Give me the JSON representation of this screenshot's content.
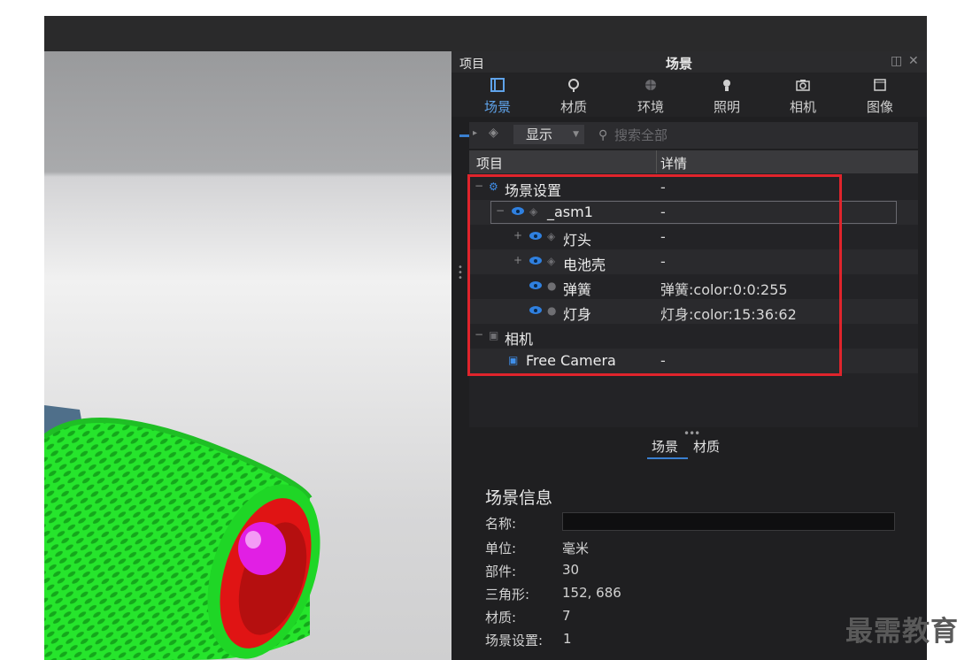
{
  "panel": {
    "title_left": "项目",
    "title": "场景",
    "restore_icon": "restore-icon",
    "close_icon": "close-icon"
  },
  "tabs": [
    {
      "label": "场景",
      "icon": "scene-icon",
      "active": true
    },
    {
      "label": "材质",
      "icon": "material-icon",
      "active": false
    },
    {
      "label": "环境",
      "icon": "environment-icon",
      "active": false
    },
    {
      "label": "照明",
      "icon": "lighting-icon",
      "active": false
    },
    {
      "label": "相机",
      "icon": "camera-icon",
      "active": false
    },
    {
      "label": "图像",
      "icon": "image-icon",
      "active": false
    }
  ],
  "toolbar": {
    "display_label": "显示",
    "search_placeholder": "搜索全部"
  },
  "tree": {
    "col_item": "项目",
    "col_detail": "详情",
    "rows": [
      {
        "label": "场景设置",
        "detail": "-"
      },
      {
        "label": "_asm1",
        "detail": "-"
      },
      {
        "label": "灯头",
        "detail": "-"
      },
      {
        "label": "电池壳",
        "detail": "-"
      },
      {
        "label": "弹簧",
        "detail": "弹簧:color:0:0:255"
      },
      {
        "label": "灯身",
        "detail": "灯身:color:15:36:62"
      },
      {
        "label": "相机",
        "detail": ""
      },
      {
        "label": "Free Camera",
        "detail": "-"
      }
    ]
  },
  "bottom_tabs": [
    {
      "label": "场景",
      "active": true
    },
    {
      "label": "材质",
      "active": false
    }
  ],
  "info": {
    "title": "场景信息",
    "name_label": "名称:",
    "name_value": "",
    "unit_label": "单位:",
    "unit_value": "毫米",
    "parts_label": "部件:",
    "parts_value": "30",
    "triangles_label": "三角形:",
    "triangles_value": "152, 686",
    "materials_label": "材质:",
    "materials_value": "7",
    "scene_settings_label": "场景设置:",
    "scene_settings_value": "1"
  },
  "watermark": "最需教育",
  "colors": {
    "accent": "#3a7fd0",
    "highlight_box": "#e0242c",
    "eye": "#2f80e0"
  }
}
